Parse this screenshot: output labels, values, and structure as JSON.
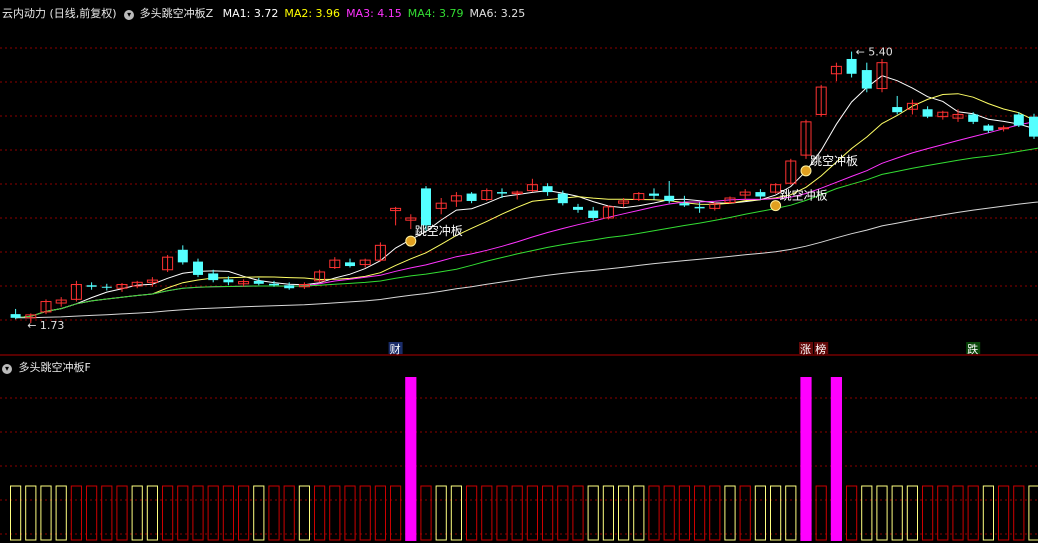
{
  "header": {
    "title": "云内动力 (日线,前复权)",
    "indicator": "多头跳空冲板Z",
    "ma_items": [
      {
        "label": "MA1:",
        "value": "3.72",
        "color": "#ffffff"
      },
      {
        "label": "MA2:",
        "value": "3.96",
        "color": "#ffff00"
      },
      {
        "label": "MA3:",
        "value": "4.15",
        "color": "#ff33ff"
      },
      {
        "label": "MA4:",
        "value": "3.79",
        "color": "#33dd33"
      },
      {
        "label": "MA6:",
        "value": "3.25",
        "color": "#e0e0e0"
      }
    ]
  },
  "sub_panel": {
    "title": "多头跳空冲板F"
  },
  "colors": {
    "up": "#ff3232",
    "down": "#54ffff",
    "grid": "#8b0000",
    "ma1": "#ffffff",
    "ma2": "#ffff66",
    "ma3": "#ff33ff",
    "ma4": "#33dd33",
    "ma6": "#d8d8d8",
    "bar_magenta": "#ff00ff",
    "bar_red": "#cc0000",
    "bar_yellow": "#ffff80"
  },
  "chart_data": [
    {
      "type": "candlestick",
      "price_range": [
        1.5,
        5.8
      ],
      "annotations": {
        "high_label": "5.40",
        "low_label": "1.73",
        "signal_label": "跳空冲板",
        "events": [
          "财",
          "涨",
          "榜",
          "跌"
        ]
      },
      "candles": [
        [
          1.85,
          1.92,
          1.78,
          1.8
        ],
        [
          1.8,
          1.86,
          1.73,
          1.84
        ],
        [
          1.88,
          2.05,
          1.85,
          2.02
        ],
        [
          2.0,
          2.08,
          1.95,
          2.04
        ],
        [
          2.05,
          2.3,
          2.02,
          2.25
        ],
        [
          2.24,
          2.28,
          2.18,
          2.22
        ],
        [
          2.22,
          2.26,
          2.17,
          2.21
        ],
        [
          2.2,
          2.27,
          2.15,
          2.25
        ],
        [
          2.23,
          2.3,
          2.2,
          2.28
        ],
        [
          2.28,
          2.35,
          2.22,
          2.31
        ],
        [
          2.45,
          2.65,
          2.42,
          2.62
        ],
        [
          2.72,
          2.78,
          2.52,
          2.55
        ],
        [
          2.56,
          2.6,
          2.35,
          2.38
        ],
        [
          2.4,
          2.45,
          2.28,
          2.31
        ],
        [
          2.32,
          2.36,
          2.24,
          2.28
        ],
        [
          2.26,
          2.32,
          2.22,
          2.29
        ],
        [
          2.3,
          2.34,
          2.24,
          2.26
        ],
        [
          2.26,
          2.3,
          2.22,
          2.24
        ],
        [
          2.24,
          2.28,
          2.18,
          2.2
        ],
        [
          2.22,
          2.28,
          2.19,
          2.25
        ],
        [
          2.3,
          2.45,
          2.28,
          2.42
        ],
        [
          2.48,
          2.62,
          2.46,
          2.58
        ],
        [
          2.55,
          2.6,
          2.48,
          2.5
        ],
        [
          2.52,
          2.6,
          2.48,
          2.58
        ],
        [
          2.58,
          2.82,
          2.56,
          2.78
        ],
        [
          3.25,
          3.3,
          3.05,
          3.28
        ],
        [
          3.12,
          3.2,
          3.0,
          3.15
        ],
        [
          3.55,
          3.58,
          2.98,
          3.05
        ],
        [
          3.28,
          3.42,
          3.2,
          3.35
        ],
        [
          3.38,
          3.5,
          3.3,
          3.45
        ],
        [
          3.48,
          3.5,
          3.35,
          3.38
        ],
        [
          3.4,
          3.55,
          3.38,
          3.52
        ],
        [
          3.5,
          3.55,
          3.42,
          3.48
        ],
        [
          3.48,
          3.52,
          3.4,
          3.5
        ],
        [
          3.52,
          3.68,
          3.5,
          3.6
        ],
        [
          3.58,
          3.62,
          3.45,
          3.5
        ],
        [
          3.48,
          3.52,
          3.32,
          3.35
        ],
        [
          3.3,
          3.34,
          3.22,
          3.26
        ],
        [
          3.25,
          3.3,
          3.12,
          3.15
        ],
        [
          3.15,
          3.32,
          3.13,
          3.3
        ],
        [
          3.35,
          3.42,
          3.3,
          3.38
        ],
        [
          3.4,
          3.5,
          3.38,
          3.48
        ],
        [
          3.48,
          3.55,
          3.4,
          3.45
        ],
        [
          3.45,
          3.65,
          3.35,
          3.38
        ],
        [
          3.35,
          3.45,
          3.3,
          3.32
        ],
        [
          3.3,
          3.36,
          3.22,
          3.28
        ],
        [
          3.28,
          3.36,
          3.25,
          3.34
        ],
        [
          3.36,
          3.44,
          3.34,
          3.42
        ],
        [
          3.46,
          3.54,
          3.4,
          3.5
        ],
        [
          3.5,
          3.54,
          3.4,
          3.44
        ],
        [
          3.5,
          3.62,
          3.48,
          3.6
        ],
        [
          3.62,
          3.95,
          3.6,
          3.92
        ],
        [
          4.0,
          4.48,
          3.95,
          4.45
        ],
        [
          4.55,
          4.95,
          4.52,
          4.92
        ],
        [
          5.1,
          5.25,
          5.0,
          5.2
        ],
        [
          5.3,
          5.4,
          5.05,
          5.1
        ],
        [
          5.15,
          5.25,
          4.85,
          4.9
        ],
        [
          4.9,
          5.3,
          4.85,
          5.25
        ],
        [
          4.65,
          4.8,
          4.55,
          4.58
        ],
        [
          4.62,
          4.75,
          4.55,
          4.7
        ],
        [
          4.62,
          4.66,
          4.5,
          4.52
        ],
        [
          4.52,
          4.6,
          4.48,
          4.58
        ],
        [
          4.5,
          4.62,
          4.45,
          4.55
        ],
        [
          4.55,
          4.58,
          4.42,
          4.45
        ],
        [
          4.4,
          4.42,
          4.3,
          4.33
        ],
        [
          4.36,
          4.4,
          4.32,
          4.37
        ],
        [
          4.55,
          4.58,
          4.38,
          4.4
        ],
        [
          4.52,
          4.56,
          4.22,
          4.25
        ],
        [
          4.22,
          4.3,
          4.15,
          4.28
        ],
        [
          4.25,
          4.3,
          4.05,
          4.08
        ],
        [
          4.08,
          4.12,
          4.05,
          4.09
        ],
        [
          4.09,
          4.16,
          4.08,
          4.14
        ]
      ]
    },
    {
      "type": "bar",
      "series": [
        {
          "name": "F",
          "values": [
            1,
            1,
            1,
            1,
            0,
            0,
            0,
            0,
            1,
            1,
            0,
            0,
            0,
            0,
            0,
            0,
            1,
            0,
            0,
            1,
            0,
            0,
            0,
            0,
            0,
            0,
            2,
            0,
            1,
            1,
            0,
            0,
            0,
            0,
            0,
            0,
            0,
            0,
            1,
            1,
            1,
            1,
            0,
            0,
            0,
            0,
            0,
            1,
            0,
            1,
            1,
            1,
            2,
            0,
            2,
            0,
            1,
            1,
            1,
            1,
            0,
            0,
            0,
            0,
            1,
            0,
            0,
            1,
            0,
            1,
            0,
            0
          ]
        }
      ]
    }
  ]
}
